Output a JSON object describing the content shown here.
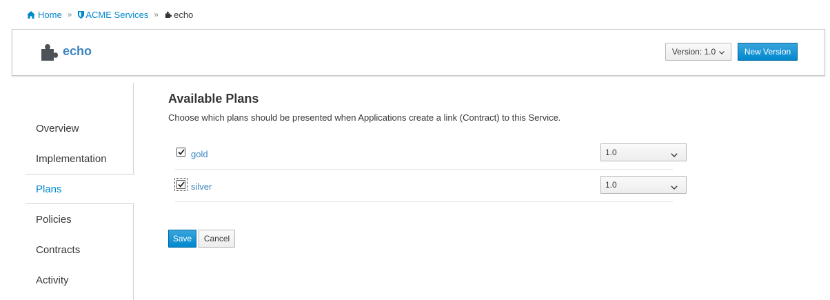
{
  "breadcrumb": {
    "home": "Home",
    "organization": "ACME Services",
    "current": "echo"
  },
  "header": {
    "service_name": "echo",
    "version_label": "Version: 1.0",
    "new_version_label": "New Version"
  },
  "nav": {
    "items": [
      {
        "label": "Overview"
      },
      {
        "label": "Implementation"
      },
      {
        "label": "Plans"
      },
      {
        "label": "Policies"
      },
      {
        "label": "Contracts"
      },
      {
        "label": "Activity"
      }
    ],
    "active": "Plans"
  },
  "plans": {
    "title": "Available Plans",
    "description": "Choose which plans should be presented when Applications create a link (Contract) to this Service.",
    "rows": [
      {
        "name": "gold",
        "checked": true,
        "version": "1.0"
      },
      {
        "name": "silver",
        "checked": true,
        "version": "1.0"
      }
    ]
  },
  "actions": {
    "save": "Save",
    "cancel": "Cancel"
  },
  "colors": {
    "link": "#0088ce",
    "primary_button": "#0088ce",
    "text": "#363636"
  },
  "icons": {
    "home": "home-icon",
    "organization": "shield-icon",
    "service": "puzzle-icon",
    "dropdown": "chevron-down-icon",
    "checkbox": "checkmark-icon"
  }
}
